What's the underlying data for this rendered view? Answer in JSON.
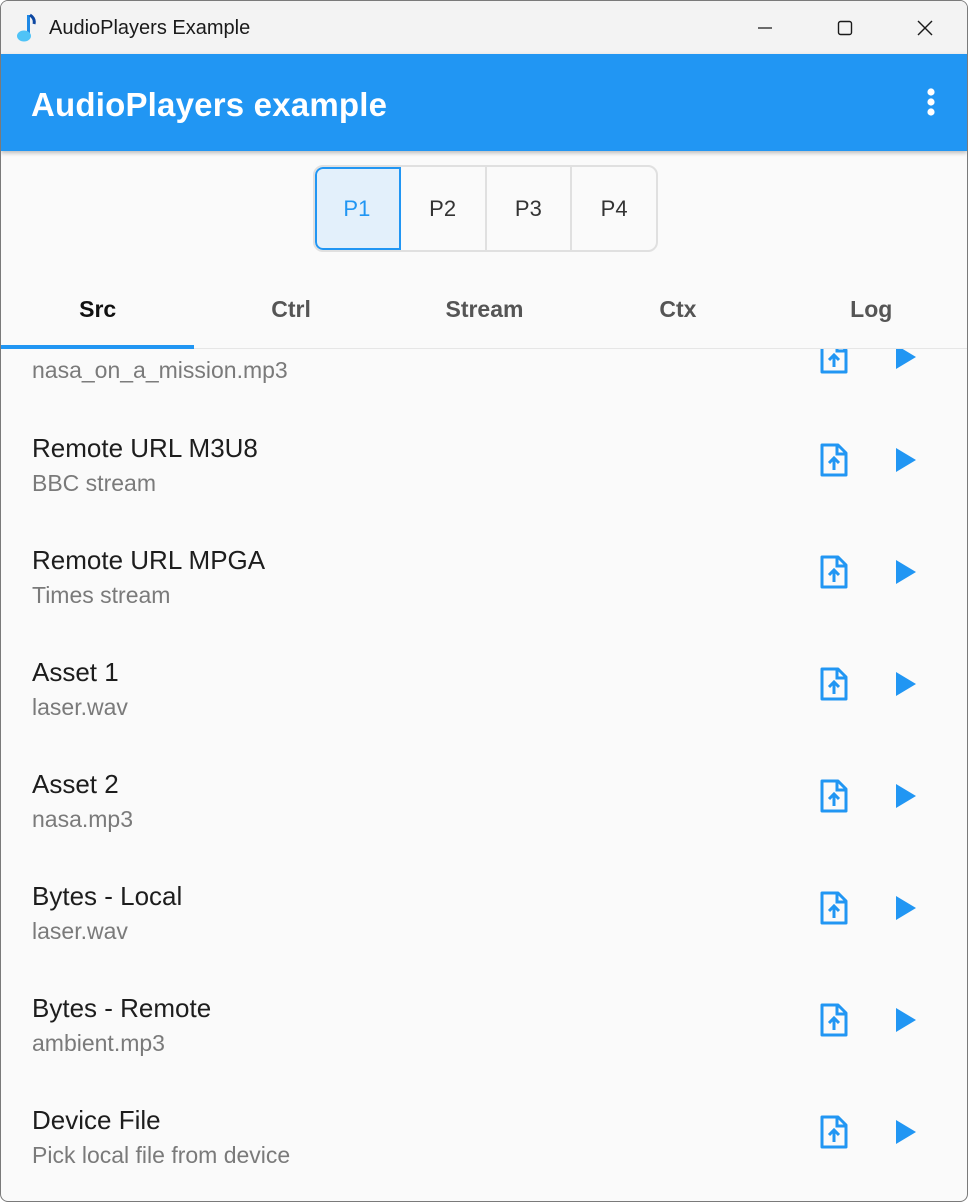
{
  "window": {
    "title": "AudioPlayers Example"
  },
  "appbar": {
    "title": "AudioPlayers example"
  },
  "players": [
    "P1",
    "P2",
    "P3",
    "P4"
  ],
  "tabs": [
    "Src",
    "Ctrl",
    "Stream",
    "Ctx",
    "Log"
  ],
  "list": {
    "items": [
      {
        "title": "",
        "subtitle": "nasa_on_a_mission.mp3"
      },
      {
        "title": "Remote URL M3U8",
        "subtitle": "BBC stream"
      },
      {
        "title": "Remote URL MPGA",
        "subtitle": "Times stream"
      },
      {
        "title": "Asset 1",
        "subtitle": "laser.wav"
      },
      {
        "title": "Asset 2",
        "subtitle": "nasa.mp3"
      },
      {
        "title": "Bytes - Local",
        "subtitle": "laser.wav"
      },
      {
        "title": "Bytes - Remote",
        "subtitle": "ambient.mp3"
      },
      {
        "title": "Device File",
        "subtitle": "Pick local file from device"
      }
    ]
  },
  "colors": {
    "accent": "#2196f3",
    "text": "#1d1d1d",
    "secondary": "#7a7a7a"
  }
}
